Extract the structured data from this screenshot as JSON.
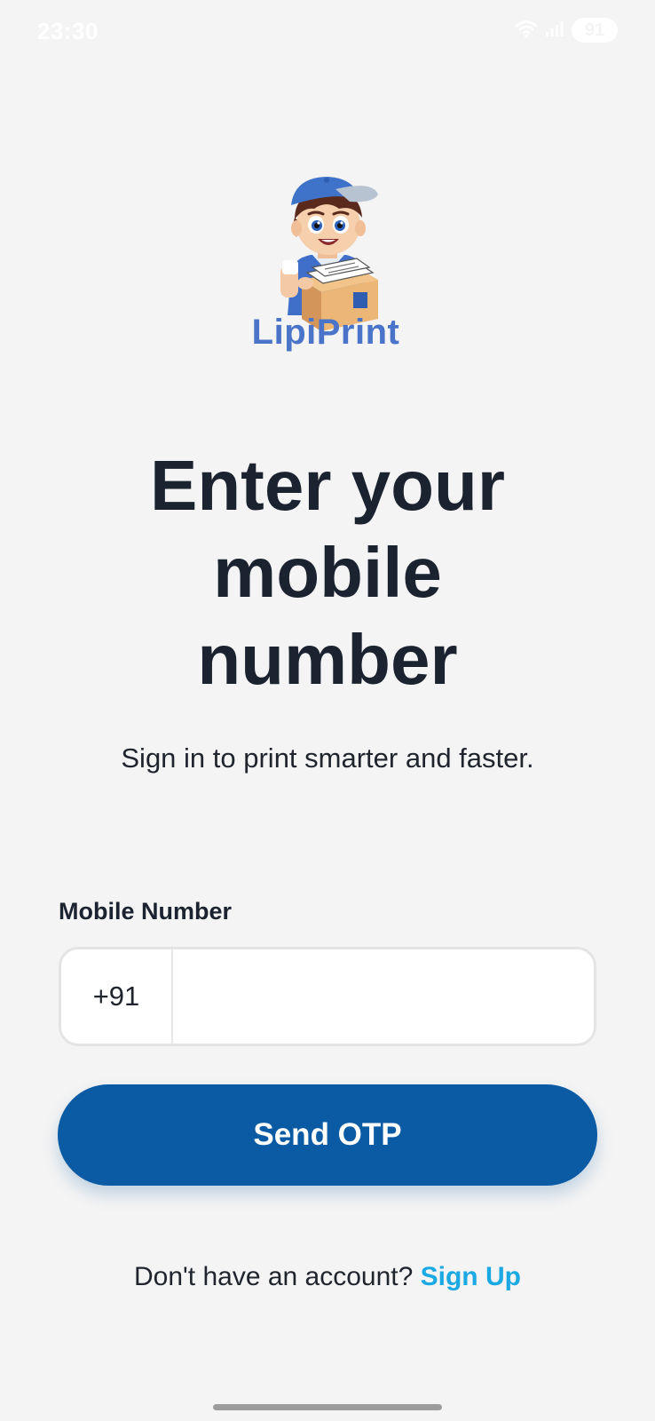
{
  "status_bar": {
    "time": "23:30",
    "battery": "91",
    "icons": [
      "wifi-icon",
      "signal-icon",
      "battery-icon"
    ]
  },
  "brand": {
    "name": "LipiPrint",
    "logo_icon": "delivery-boy-mascot-icon",
    "color": "#4a74c9"
  },
  "login": {
    "title_lines": [
      "Enter your",
      "mobile",
      "number"
    ],
    "subtitle": "Sign in to print smarter and faster.",
    "field_label": "Mobile Number",
    "country_code": "+91",
    "phone_value": "",
    "phone_placeholder": "",
    "send_otp_label": "Send OTP",
    "signup_prompt": "Don't have an account?",
    "signup_link": "Sign Up"
  },
  "colors": {
    "background": "#f4f4f4",
    "primary_button": "#0a5aa4",
    "link": "#1aa9e2",
    "title": "#1b2230"
  }
}
